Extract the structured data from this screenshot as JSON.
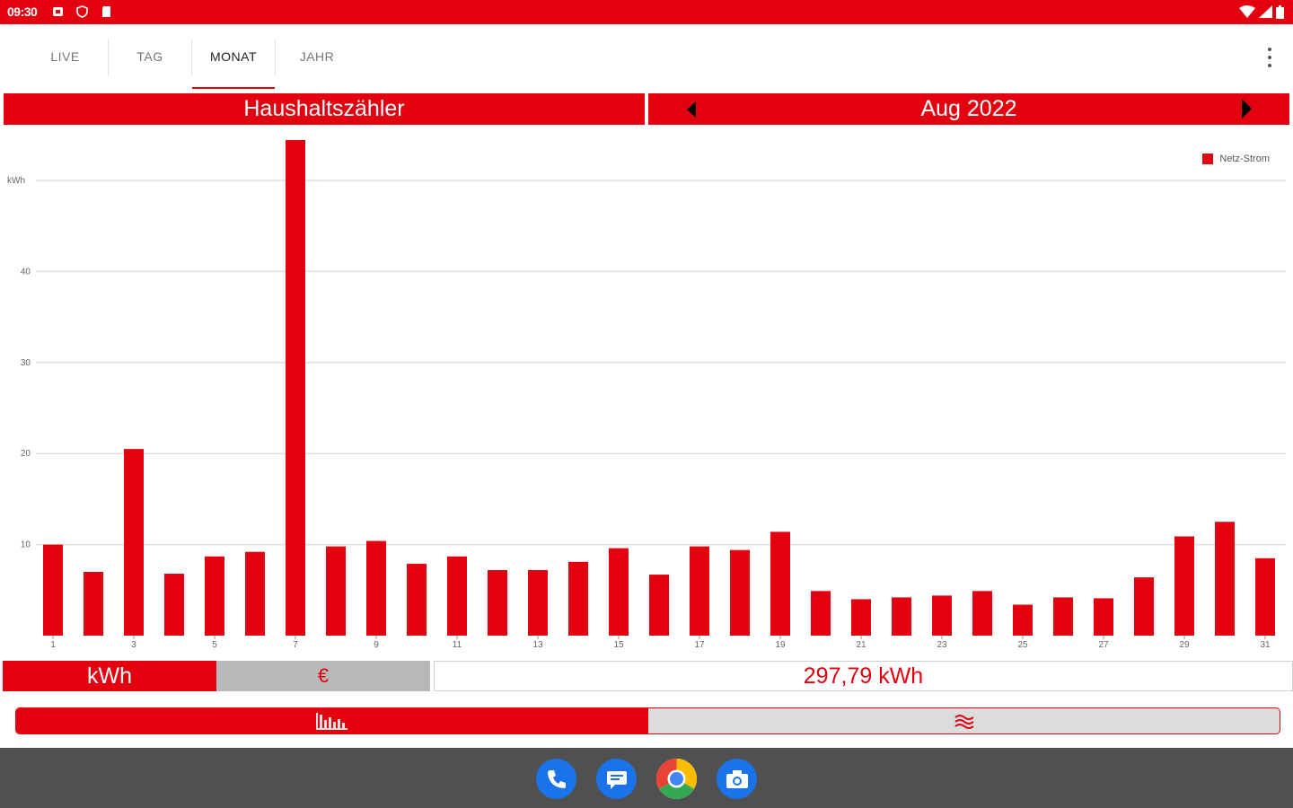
{
  "status_bar": {
    "time": "09:30"
  },
  "tabs": [
    {
      "label": "LIVE",
      "active": false
    },
    {
      "label": "TAG",
      "active": false
    },
    {
      "label": "MONAT",
      "active": true
    },
    {
      "label": "JAHR",
      "active": false
    }
  ],
  "header": {
    "meter_name": "Haushaltszähler",
    "period": "Aug 2022"
  },
  "chart_data": {
    "type": "bar",
    "ylabel": "kWh",
    "ylim": [
      0,
      50
    ],
    "yticks": [
      10,
      20,
      30,
      40
    ],
    "series": [
      {
        "name": "Netz-Strom",
        "color": "#e3000f",
        "values": [
          10,
          7,
          20.5,
          6.8,
          8.7,
          9.2,
          54.5,
          9.8,
          10.4,
          7.9,
          8.7,
          7.2,
          7.2,
          8.1,
          9.6,
          6.7,
          9.8,
          9.4,
          11.4,
          4.9,
          4,
          4.2,
          4.4,
          4.9,
          3.4,
          4.2,
          4.1,
          6.4,
          10.9,
          12.5,
          8.5
        ]
      }
    ],
    "categories": [
      "1",
      "2",
      "3",
      "4",
      "5",
      "6",
      "7",
      "8",
      "9",
      "10",
      "11",
      "12",
      "13",
      "14",
      "15",
      "16",
      "17",
      "18",
      "19",
      "20",
      "21",
      "22",
      "23",
      "24",
      "25",
      "26",
      "27",
      "28",
      "29",
      "30",
      "31"
    ],
    "x_tick_labels": [
      "1",
      "3",
      "5",
      "7",
      "9",
      "11",
      "13",
      "15",
      "17",
      "19",
      "21",
      "23",
      "25",
      "27",
      "29",
      "31"
    ],
    "grid": true,
    "legend": "top-right"
  },
  "units": {
    "kwh_label": "kWh",
    "eur_label": "€"
  },
  "total": "297,79 kWh",
  "view_toggle": {
    "bars_icon": "bar-chart-icon",
    "curve_icon": "wave-icon"
  },
  "dock": [
    {
      "icon": "phone-icon",
      "color": "#1a73e8"
    },
    {
      "icon": "messages-icon",
      "color": "#1a73e8"
    },
    {
      "icon": "chrome-icon",
      "color": "#ffffff"
    },
    {
      "icon": "camera-icon",
      "color": "#1a73e8"
    }
  ],
  "colors": {
    "accent": "#e3000f",
    "inactive": "#b8b8b8",
    "dock_bg": "#505050"
  }
}
